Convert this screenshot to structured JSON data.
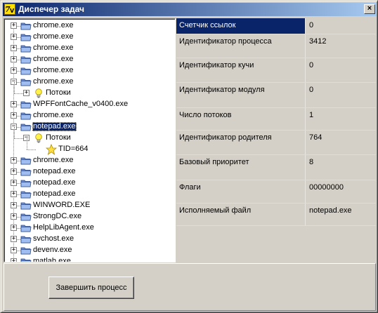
{
  "window": {
    "title": "Диспечер задач",
    "close_label": "×"
  },
  "tree": {
    "rows": [
      {
        "label": "chrome.exe",
        "kind": "folder",
        "expander": "+"
      },
      {
        "label": "chrome.exe",
        "kind": "folder",
        "expander": "+"
      },
      {
        "label": "chrome.exe",
        "kind": "folder",
        "expander": "+"
      },
      {
        "label": "chrome.exe",
        "kind": "folder",
        "expander": "+"
      },
      {
        "label": "chrome.exe",
        "kind": "folder",
        "expander": "+"
      },
      {
        "label": "chrome.exe",
        "kind": "folder",
        "expander": "−"
      },
      {
        "label": "Потоки",
        "kind": "bulb",
        "expander": "+"
      },
      {
        "label": "WPFFontCache_v0400.exe",
        "kind": "folder",
        "expander": "+"
      },
      {
        "label": "chrome.exe",
        "kind": "folder",
        "expander": "+"
      },
      {
        "label": "notepad.exe",
        "kind": "folder",
        "expander": "−",
        "selected": true
      },
      {
        "label": "Потоки",
        "kind": "bulb",
        "expander": "−"
      },
      {
        "label": "TID=664",
        "kind": "star",
        "expander": ""
      },
      {
        "label": "chrome.exe",
        "kind": "folder",
        "expander": "+"
      },
      {
        "label": "notepad.exe",
        "kind": "folder",
        "expander": "+"
      },
      {
        "label": "notepad.exe",
        "kind": "folder",
        "expander": "+"
      },
      {
        "label": "notepad.exe",
        "kind": "folder",
        "expander": "+"
      },
      {
        "label": "WINWORD.EXE",
        "kind": "folder",
        "expander": "+"
      },
      {
        "label": "StrongDC.exe",
        "kind": "folder",
        "expander": "+"
      },
      {
        "label": "HelpLibAgent.exe",
        "kind": "folder",
        "expander": "+"
      },
      {
        "label": "svchost.exe",
        "kind": "folder",
        "expander": "+"
      },
      {
        "label": "devenv.exe",
        "kind": "folder",
        "expander": "+"
      },
      {
        "label": "matlab.exe",
        "kind": "folder",
        "expander": "+"
      }
    ]
  },
  "properties": [
    {
      "name": "Счетчик ссылок",
      "value": "0",
      "selected": true
    },
    {
      "name": "Идентификатор процесса",
      "value": "3412"
    },
    {
      "name": "Идентификатор кучи",
      "value": "0"
    },
    {
      "name": "Идентификатор модуля",
      "value": "0"
    },
    {
      "name": "Число потоков",
      "value": "1"
    },
    {
      "name": "Идентификатор родителя",
      "value": "764"
    },
    {
      "name": "Базовый приоритет",
      "value": "8"
    },
    {
      "name": "Флаги",
      "value": "00000000"
    },
    {
      "name": "Исполняемый файл",
      "value": "notepad.exe"
    }
  ],
  "actions": {
    "end_process_label": "Завершить процесс"
  },
  "colors": {
    "selection": "#0a246a",
    "face": "#d4d0c8"
  }
}
